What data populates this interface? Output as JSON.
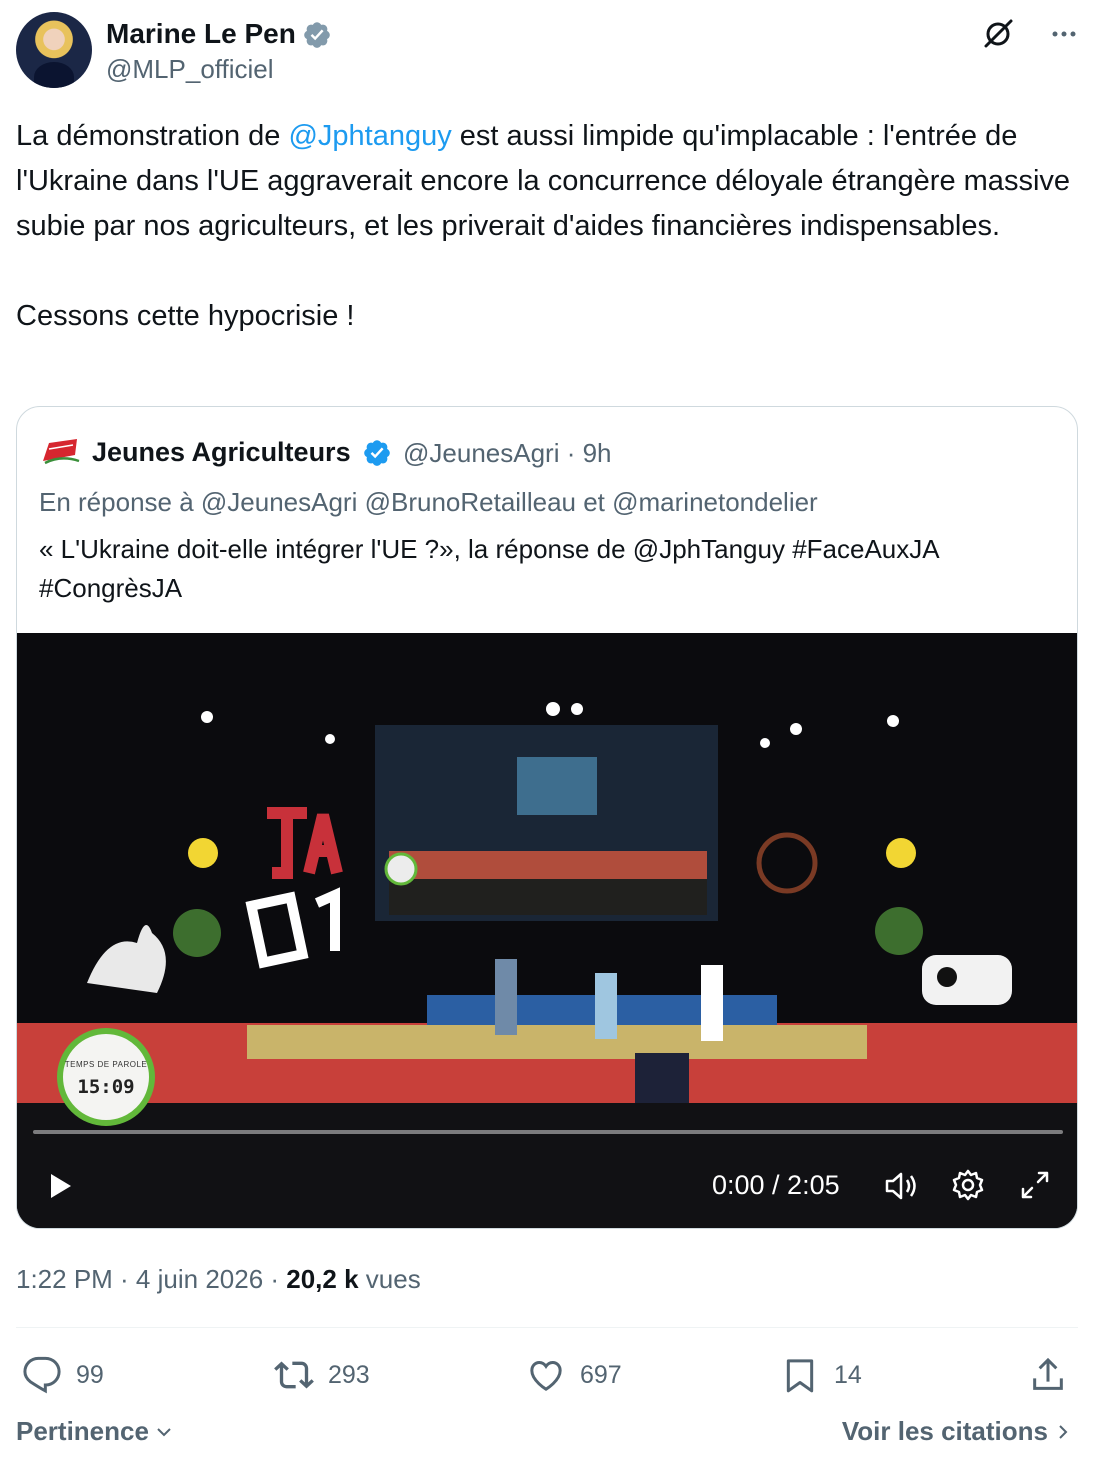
{
  "author": {
    "name": "Marine Le Pen",
    "handle": "@MLP_officiel"
  },
  "tweet": {
    "part1": "La démonstration de ",
    "mention": "@Jphtanguy",
    "part2": " est aussi limpide qu'implacable : l'entrée de l'Ukraine dans l'UE aggraverait encore la concurrence déloyale étrangère massive subie par nos agriculteurs, et les priverait d'aides financières indispensables.\n\nCessons cette hypocrisie !"
  },
  "quote": {
    "name": "Jeunes Agriculteurs",
    "handle": "@JeunesAgri",
    "time": "· 9h",
    "reply_prefix": "En réponse à ",
    "reply_to": "@JeunesAgri @BrunoRetailleau  et  @marinetondelier",
    "text": "« L'Ukraine doit-elle intégrer l'UE ?», la réponse de @JphTanguy #FaceAuxJA #CongrèsJA",
    "video": {
      "timer_label": "TEMPS DE PAROLE",
      "timer_value": "15:09",
      "time": "0:00 / 2:05",
      "progress": 0
    }
  },
  "meta": {
    "time": "1:22 PM · 4 juin 2026 · ",
    "views_count": "20,2 k",
    "views_label": " vues"
  },
  "actions": {
    "replies": "99",
    "retweets": "293",
    "likes": "697",
    "bookmarks": "14"
  },
  "footer": {
    "sort": "Pertinence",
    "quotes": "Voir les citations"
  },
  "colors": {
    "accent": "#1d9bf0",
    "muted": "#536471",
    "text": "#0f1419"
  }
}
